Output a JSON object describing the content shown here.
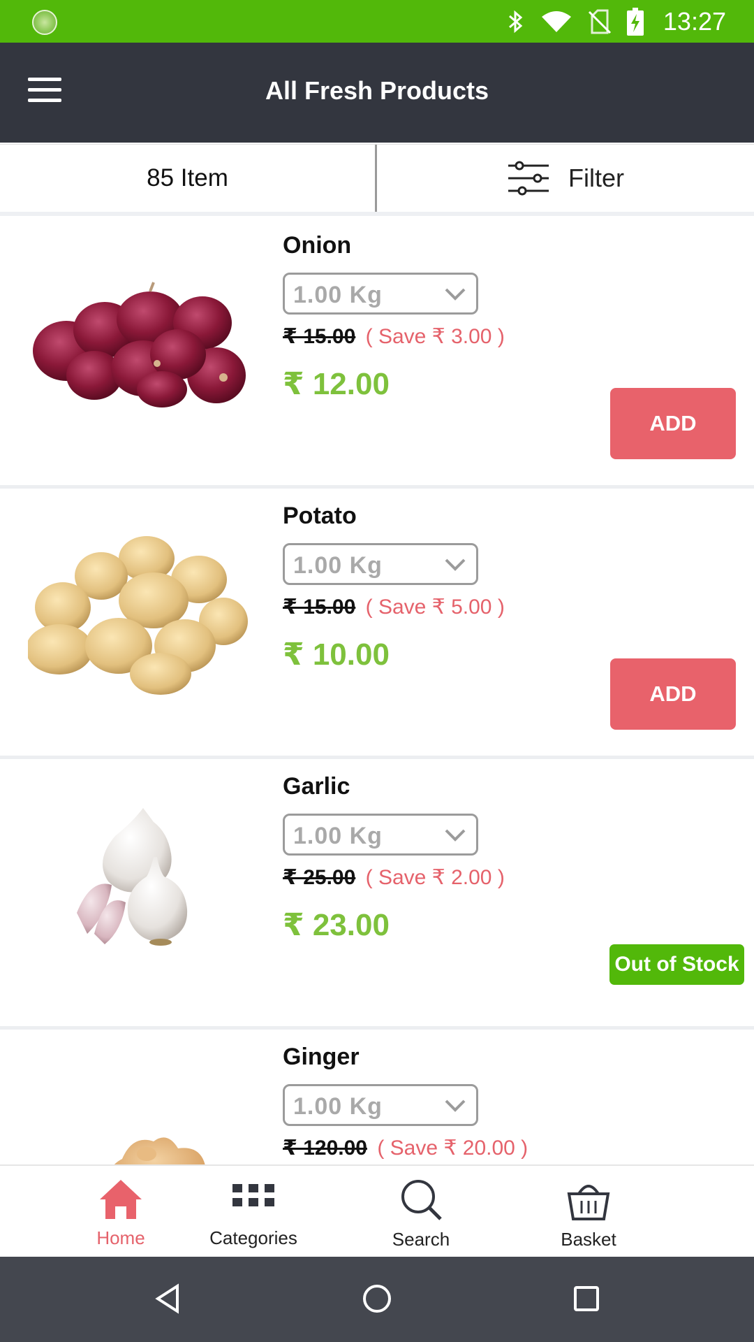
{
  "status_bar": {
    "time": "13:27",
    "icons": [
      "app-notification-icon",
      "bluetooth-icon",
      "wifi-icon",
      "no-sim-icon",
      "battery-charging-icon"
    ]
  },
  "app_bar": {
    "title": "All Fresh Products",
    "menu_icon": "hamburger-menu-icon"
  },
  "toolbar": {
    "item_count": "85 Item",
    "filter_label": "Filter",
    "filter_icon": "sliders-icon"
  },
  "products": [
    {
      "name": "Onion",
      "quantity": "1.00 Kg",
      "mrp": "₹ 15.00",
      "save": "( Save ₹ 3.00 )",
      "price": "₹ 12.00",
      "action": "ADD",
      "in_stock": true,
      "image": "onion"
    },
    {
      "name": "Potato",
      "quantity": "1.00 Kg",
      "mrp": "₹ 15.00",
      "save": "( Save ₹ 5.00 )",
      "price": "₹ 10.00",
      "action": "ADD",
      "in_stock": true,
      "image": "potato"
    },
    {
      "name": "Garlic",
      "quantity": "1.00 Kg",
      "mrp": "₹ 25.00",
      "save": "( Save ₹ 2.00 )",
      "price": "₹ 23.00",
      "action": "Out of Stock",
      "in_stock": false,
      "image": "garlic"
    },
    {
      "name": "Ginger",
      "quantity": "1.00 Kg",
      "mrp": "₹ 120.00",
      "save": "( Save ₹ 20.00 )",
      "price": "",
      "action": "",
      "in_stock": true,
      "image": "ginger"
    }
  ],
  "bottom_nav": [
    {
      "label": "Home",
      "icon": "home-icon",
      "active": true
    },
    {
      "label": "Categories",
      "icon": "grid-icon",
      "active": false
    },
    {
      "label": "Search",
      "icon": "search-icon",
      "active": false
    },
    {
      "label": "Basket",
      "icon": "basket-icon",
      "active": false
    }
  ],
  "colors": {
    "status_bar": "#52b80a",
    "app_bar": "#33363f",
    "accent_red": "#e8626b",
    "price_green": "#7ec13c",
    "stock_green": "#52b80a"
  }
}
